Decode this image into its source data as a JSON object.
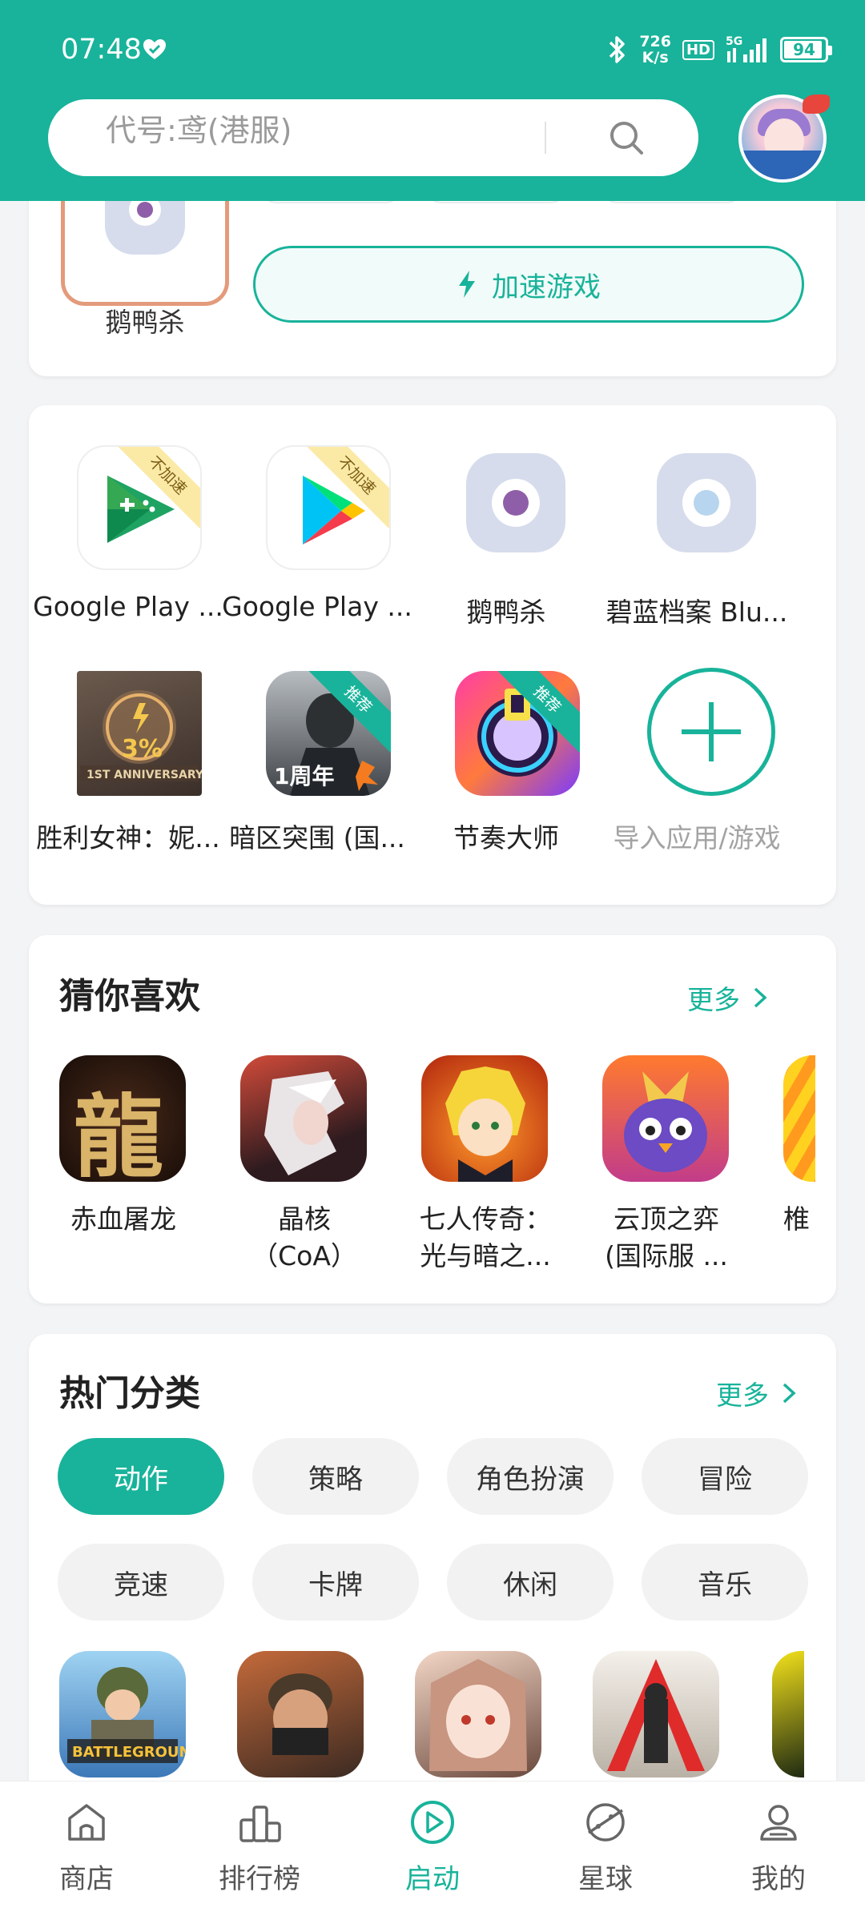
{
  "status_bar": {
    "time": "07:48",
    "net_speed_value": "726",
    "net_speed_unit": "K/s",
    "hd_badge": "HD",
    "signal_label": "5G",
    "battery_level": "94",
    "battery_fraction": 0.94
  },
  "search": {
    "placeholder": "代号:鸢(港服)"
  },
  "current_game": {
    "name": "鹅鸭杀",
    "accelerate_label": "加速游戏"
  },
  "my_apps": [
    {
      "label": "Google Play ...",
      "badge": "不加速",
      "icon": "google-play-games-icon"
    },
    {
      "label": "Google Play ...",
      "badge": "不加速",
      "icon": "google-play-store-icon"
    },
    {
      "label": "鹅鸭杀",
      "badge": "",
      "icon": "goose-duck-icon"
    },
    {
      "label": "碧蓝档案 Blu...",
      "badge": "",
      "icon": "blue-archive-icon"
    },
    {
      "label": "胜利女神：妮...",
      "badge": "",
      "icon": "nikke-icon",
      "overlay": "3%"
    },
    {
      "label": "暗区突围 (国...",
      "badge": "推荐",
      "icon": "arena-breakout-icon",
      "overlay": "1周年"
    },
    {
      "label": "节奏大师",
      "badge": "推荐",
      "icon": "rhythm-master-icon"
    },
    {
      "label": "导入应用/游戏",
      "badge": "",
      "icon": "add-icon"
    }
  ],
  "recommend": {
    "title": "猜你喜欢",
    "more_label": "更多",
    "items": [
      {
        "label": "赤血屠龙",
        "icon": "dragon-game-icon",
        "glyph": "龍"
      },
      {
        "label": "晶核\n（CoA）",
        "icon": "coa-game-icon"
      },
      {
        "label": "七人传奇：\n光与暗之...",
        "icon": "seven-deadly-sins-icon"
      },
      {
        "label": "云顶之弈\n(国际服 ...",
        "icon": "tft-game-icon"
      },
      {
        "label": "椎",
        "icon": "partial-game-icon"
      }
    ]
  },
  "categories": {
    "title": "热门分类",
    "more_label": "更多",
    "chips": [
      "动作",
      "策略",
      "角色扮演",
      "冒险",
      "竞速",
      "卡牌",
      "休闲",
      "音乐"
    ],
    "active_index": 0
  },
  "bottom_nav": [
    {
      "label": "商店",
      "icon": "store-icon"
    },
    {
      "label": "排行榜",
      "icon": "ranking-icon"
    },
    {
      "label": "启动",
      "icon": "launch-icon"
    },
    {
      "label": "星球",
      "icon": "planet-icon"
    },
    {
      "label": "我的",
      "icon": "profile-icon"
    }
  ],
  "active_nav_index": 2,
  "colors": {
    "accent": "#18b39a",
    "header_bg": "#18b39a",
    "page_bg": "#f3f4f6",
    "ribbon_yellow": "#fbe9a6"
  }
}
